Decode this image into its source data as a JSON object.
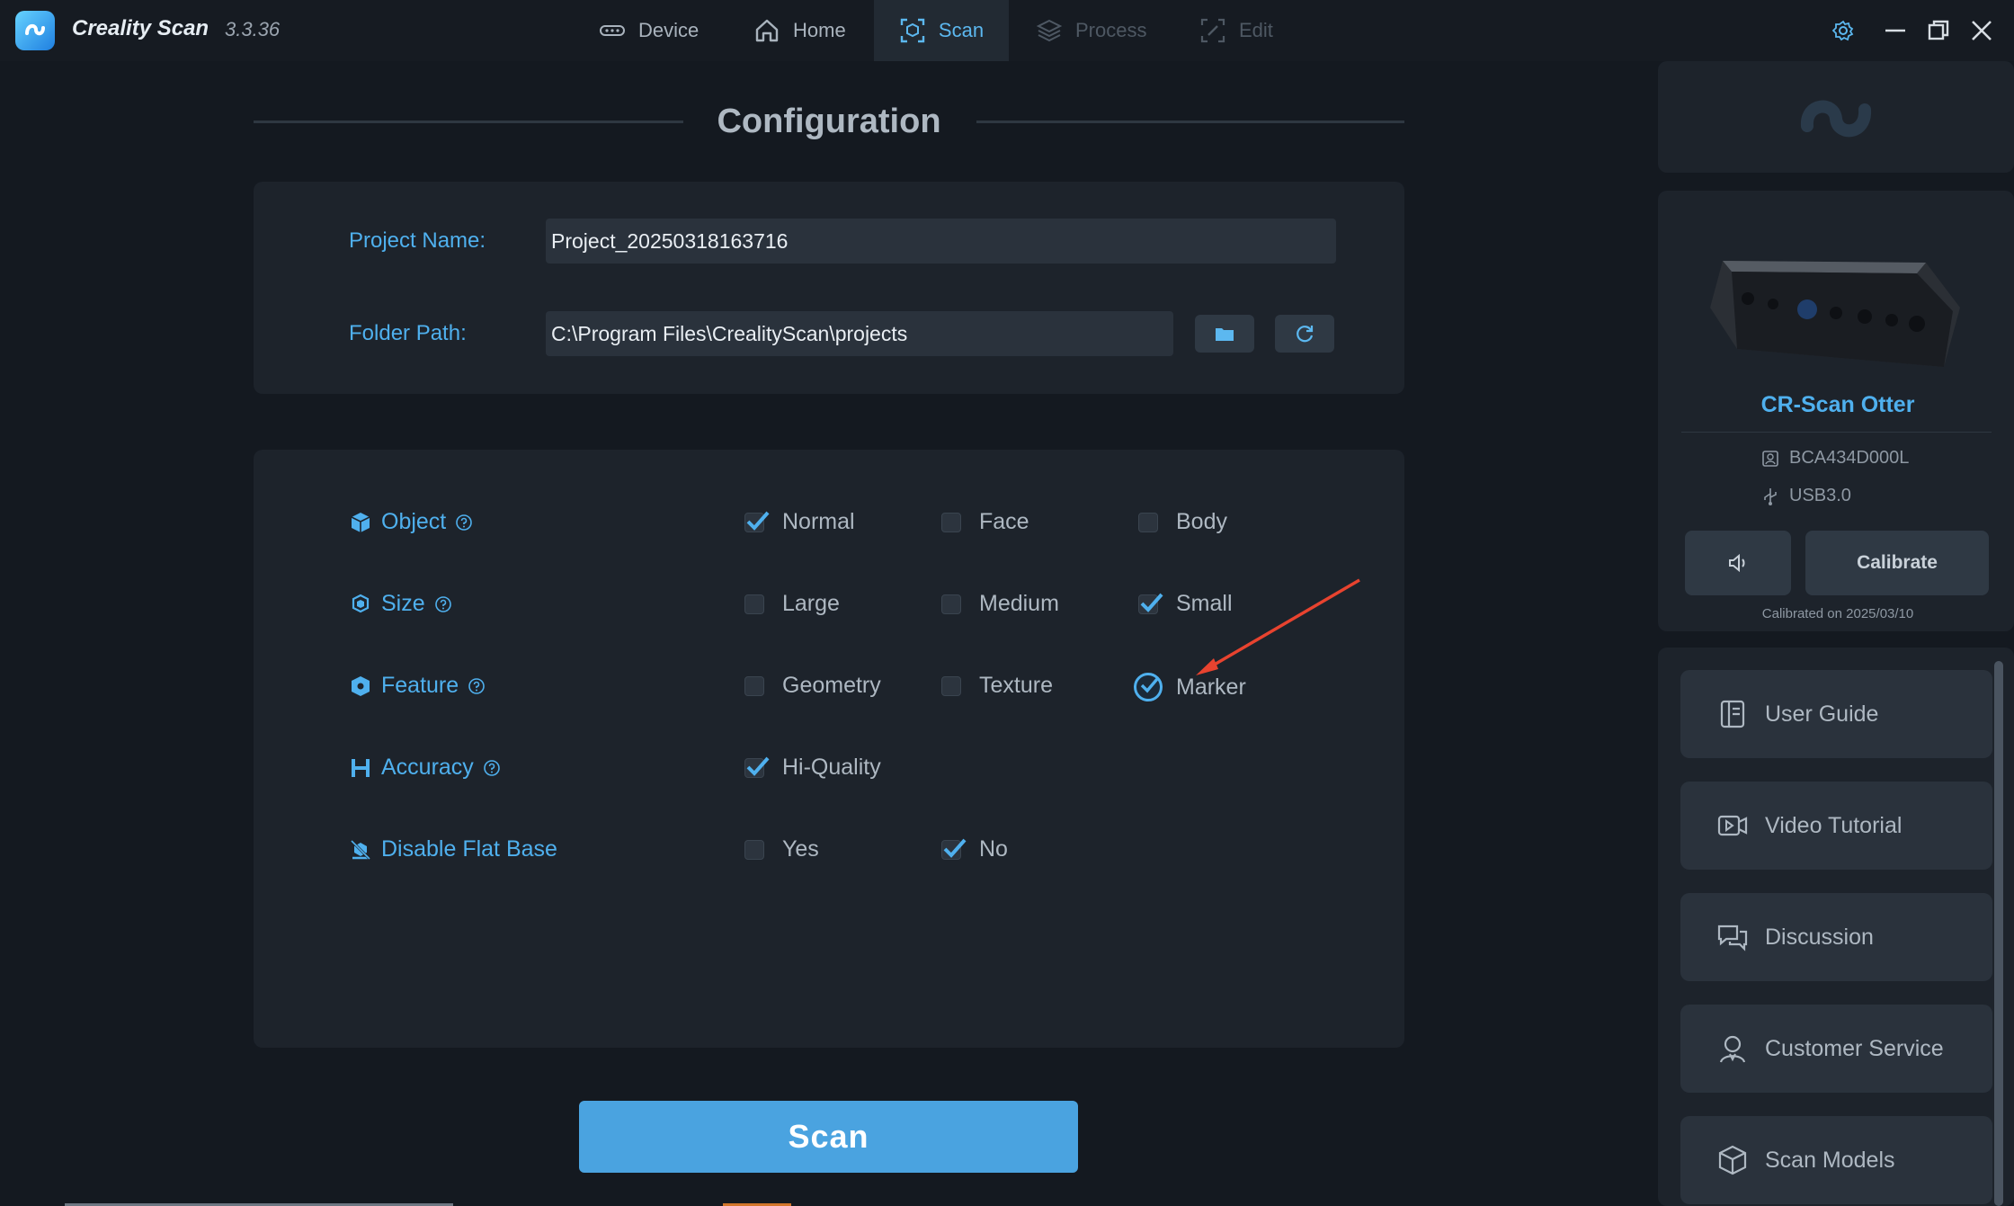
{
  "titlebar": {
    "app_name": "Creality Scan",
    "version": "3.3.36",
    "tabs": [
      {
        "label": "Device",
        "icon": "device-icon",
        "state": "normal"
      },
      {
        "label": "Home",
        "icon": "home-icon",
        "state": "normal"
      },
      {
        "label": "Scan",
        "icon": "scan-icon",
        "state": "active"
      },
      {
        "label": "Process",
        "icon": "layers-icon",
        "state": "disabled"
      },
      {
        "label": "Edit",
        "icon": "edit-icon",
        "state": "disabled"
      }
    ],
    "controls": [
      "settings-icon",
      "minimize-icon",
      "restore-icon",
      "close-icon"
    ]
  },
  "config": {
    "title": "Configuration",
    "project_name_label": "Project Name:",
    "project_name_value": "Project_20250318163716",
    "folder_path_label": "Folder Path:",
    "folder_path_value": "C:\\Program Files\\CrealityScan\\projects",
    "browse_icon": "folder-icon",
    "reset_icon": "refresh-icon"
  },
  "options": [
    {
      "label": "Object",
      "help": true,
      "choices": [
        {
          "label": "Normal",
          "checked": true
        },
        {
          "label": "Face",
          "checked": false
        },
        {
          "label": "Body",
          "checked": false
        }
      ]
    },
    {
      "label": "Size",
      "help": true,
      "choices": [
        {
          "label": "Large",
          "checked": false
        },
        {
          "label": "Medium",
          "checked": false
        },
        {
          "label": "Small",
          "checked": true
        }
      ]
    },
    {
      "label": "Feature",
      "help": true,
      "choices": [
        {
          "label": "Geometry",
          "checked": false
        },
        {
          "label": "Texture",
          "checked": false
        },
        {
          "label": "Marker",
          "checked": true
        }
      ]
    },
    {
      "label": "Accuracy",
      "help": true,
      "choices": [
        {
          "label": "Hi-Quality",
          "checked": true
        }
      ]
    },
    {
      "label": "Disable Flat Base",
      "help": false,
      "choices": [
        {
          "label": "Yes",
          "checked": false
        },
        {
          "label": "No",
          "checked": true
        }
      ]
    }
  ],
  "scan_button": {
    "label": "Scan"
  },
  "device": {
    "name": "CR-Scan Otter",
    "serial": "BCA434D000L",
    "connection": "USB3.0",
    "sound_icon": "speaker-icon",
    "calibrate_label": "Calibrate",
    "calibrated_text": "Calibrated on 2025/03/10"
  },
  "links": [
    {
      "label": "User Guide",
      "icon": "book-icon"
    },
    {
      "label": "Video Tutorial",
      "icon": "video-icon"
    },
    {
      "label": "Discussion",
      "icon": "chat-icon"
    },
    {
      "label": "Customer Service",
      "icon": "agent-icon"
    },
    {
      "label": "Scan Models",
      "icon": "cube-icon"
    }
  ],
  "colors": {
    "accent": "#4fb0ee",
    "scan_button": "#4aa3e0",
    "annotation_arrow": "#e8432f"
  }
}
